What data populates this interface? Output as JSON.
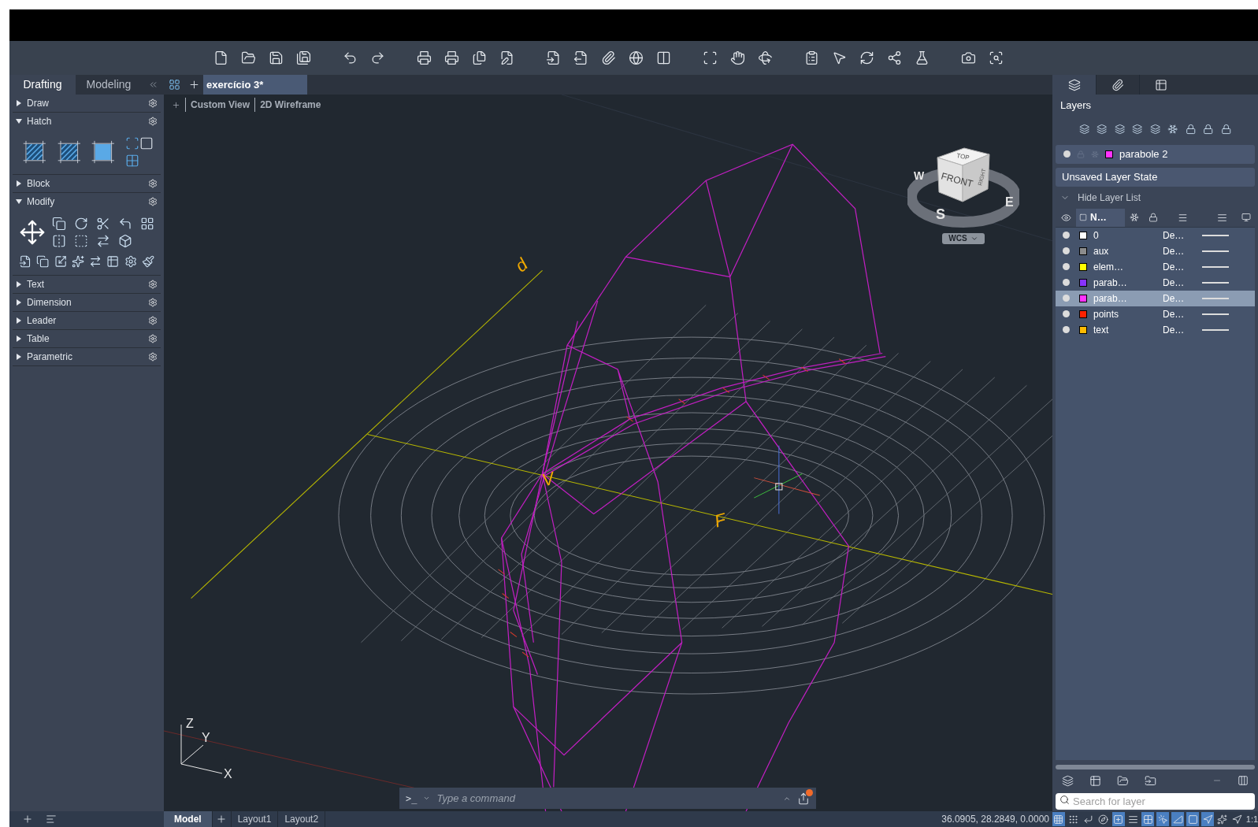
{
  "ribbon_tabs": [
    {
      "label": "Drafting",
      "selected": true
    },
    {
      "label": "Modeling",
      "selected": false
    }
  ],
  "document_tabs": [
    {
      "label": "exercício 3*",
      "selected": true
    }
  ],
  "viewport_controls": [
    {
      "label": "Custom View"
    },
    {
      "label": "2D Wireframe"
    }
  ],
  "tool_sections": [
    {
      "label": "Draw",
      "expanded": false,
      "kind": "plain"
    },
    {
      "label": "Hatch",
      "expanded": true,
      "kind": "hatch"
    },
    {
      "label": "Block",
      "expanded": false,
      "kind": "plain"
    },
    {
      "label": "Modify",
      "expanded": true,
      "kind": "modify"
    },
    {
      "label": "Text",
      "expanded": false,
      "kind": "plain"
    },
    {
      "label": "Dimension",
      "expanded": false,
      "kind": "plain"
    },
    {
      "label": "Leader",
      "expanded": false,
      "kind": "plain"
    },
    {
      "label": "Table",
      "expanded": false,
      "kind": "plain"
    },
    {
      "label": "Parametric",
      "expanded": false,
      "kind": "plain"
    }
  ],
  "canvas": {
    "labels": [
      {
        "text": "d",
        "kind": "line"
      },
      {
        "text": "V",
        "kind": "vertex"
      },
      {
        "text": "F",
        "kind": "focus"
      }
    ],
    "ucs": {
      "z": "Z",
      "y": "Y",
      "x": "X"
    },
    "viewcube": {
      "top": "TOP",
      "front": "FRONT",
      "right": "RIGHT",
      "west": "W",
      "south": "S",
      "east": "E",
      "wcs": "WCS"
    }
  },
  "command_line": {
    "prompt": ">_",
    "placeholder": "Type a command"
  },
  "layout_tabs": [
    {
      "label": "Model",
      "selected": true
    },
    {
      "label": "Layout1",
      "selected": false
    },
    {
      "label": "Layout2",
      "selected": false
    }
  ],
  "status_bar": {
    "coordinates": "36.0905, 28.2849, 0.0000",
    "scale": "1:1",
    "toggles": [
      {
        "kind": "grid",
        "on": true
      },
      {
        "kind": "snap",
        "on": false
      },
      {
        "kind": "ortho",
        "on": false
      },
      {
        "kind": "polar",
        "on": false
      },
      {
        "kind": "dyninput",
        "on": true
      },
      {
        "kind": "lineweight",
        "on": false
      },
      {
        "kind": "transparency",
        "on": true
      },
      {
        "kind": "selection",
        "on": true
      },
      {
        "kind": "angle",
        "on": true
      },
      {
        "kind": "ucs",
        "on": true
      },
      {
        "kind": "annotation",
        "on": true
      },
      {
        "kind": "autoscale",
        "on": false
      },
      {
        "kind": "annoscale",
        "on": false
      }
    ]
  },
  "layers_panel": {
    "tabs": [
      {
        "selected": true
      },
      {
        "selected": false
      },
      {
        "selected": false
      }
    ],
    "title": "Layers",
    "current_layer": {
      "name": "parabole 2",
      "color": "#ff33ff"
    },
    "layer_state": "Unsaved Layer State",
    "hide_list": "Hide Layer List",
    "name_column": "N…",
    "layers": [
      {
        "name": "0",
        "color": "#ffffff",
        "linetype": "De…",
        "selected": false
      },
      {
        "name": "aux",
        "color": "#8c8c8c",
        "linetype": "De…",
        "selected": false
      },
      {
        "name": "elem…",
        "color": "#ffff00",
        "linetype": "De…",
        "selected": false
      },
      {
        "name": "parab…",
        "color": "#8833ff",
        "linetype": "De…",
        "selected": false
      },
      {
        "name": "parab…",
        "color": "#ff33ff",
        "linetype": "De…",
        "selected": true
      },
      {
        "name": "points",
        "color": "#ff2200",
        "linetype": "De…",
        "selected": false
      },
      {
        "name": "text",
        "color": "#ffbb00",
        "linetype": "De…",
        "selected": false
      }
    ],
    "search": {
      "placeholder": "Search for layer"
    }
  }
}
